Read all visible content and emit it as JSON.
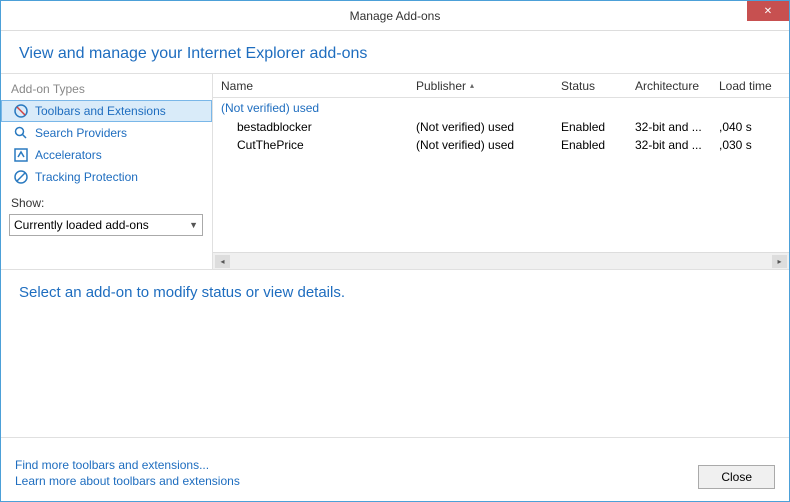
{
  "window": {
    "title": "Manage Add-ons"
  },
  "header": {
    "text": "View and manage your Internet Explorer add-ons"
  },
  "sidebar": {
    "types_label": "Add-on Types",
    "items": [
      {
        "label": "Toolbars and Extensions"
      },
      {
        "label": "Search Providers"
      },
      {
        "label": "Accelerators"
      },
      {
        "label": "Tracking Protection"
      }
    ],
    "show_label": "Show:",
    "dropdown_value": "Currently loaded add-ons"
  },
  "table": {
    "headers": {
      "name": "Name",
      "publisher": "Publisher",
      "status": "Status",
      "architecture": "Architecture",
      "load_time": "Load time"
    },
    "group": "(Not verified) used",
    "rows": [
      {
        "name": "bestadblocker",
        "publisher": "(Not verified) used",
        "status": "Enabled",
        "architecture": "32-bit and ...",
        "load_time": ",040 s"
      },
      {
        "name": "CutThePrice",
        "publisher": "(Not verified) used",
        "status": "Enabled",
        "architecture": "32-bit and ...",
        "load_time": ",030 s"
      }
    ]
  },
  "details": {
    "prompt": "Select an add-on to modify status or view details."
  },
  "footer": {
    "link1": "Find more toolbars and extensions...",
    "link2": "Learn more about toolbars and extensions",
    "close_label": "Close"
  }
}
